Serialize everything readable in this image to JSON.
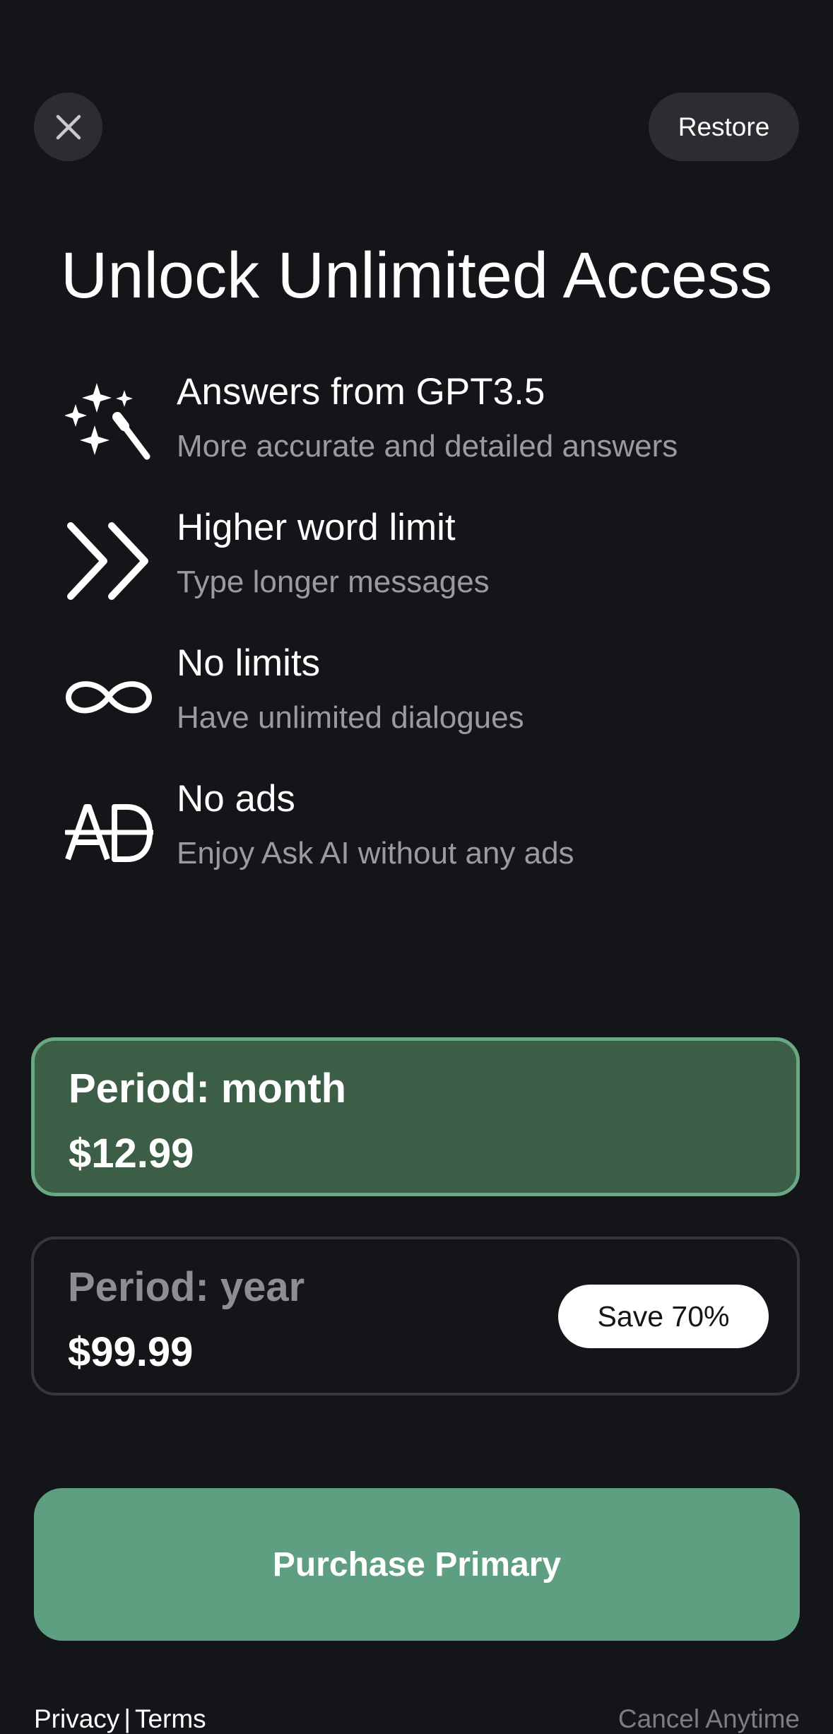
{
  "header": {
    "close_icon": "close-icon",
    "restore_label": "Restore"
  },
  "title": "Unlock Unlimited Access",
  "features": [
    {
      "icon": "magic-wand-sparkles-icon",
      "title": "Answers from GPT3.5",
      "subtitle": "More accurate and detailed answers"
    },
    {
      "icon": "double-chevron-right-icon",
      "title": "Higher word limit",
      "subtitle": "Type longer messages"
    },
    {
      "icon": "infinity-icon",
      "title": "No limits",
      "subtitle": "Have unlimited dialogues"
    },
    {
      "icon": "no-ads-icon",
      "title": "No ads",
      "subtitle": "Enjoy Ask AI without any ads"
    }
  ],
  "plans": [
    {
      "period": "Period: month",
      "price": "$12.99",
      "selected": true
    },
    {
      "period": "Period: year",
      "price": "$99.99",
      "badge": "Save 70%",
      "selected": false
    }
  ],
  "purchase_label": "Purchase Primary",
  "footer": {
    "privacy": "Privacy",
    "separator": "|",
    "terms": "Terms",
    "cancel": "Cancel Anytime"
  },
  "colors": {
    "background": "#141519",
    "selected_plan_bg": "#3c5e47",
    "selected_plan_border": "#6aa883",
    "purchase_button": "#5f9f81"
  }
}
